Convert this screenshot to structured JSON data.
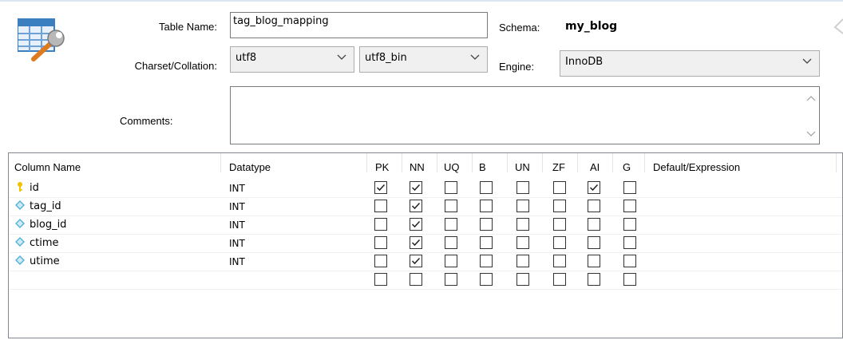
{
  "header": {
    "table_name_label": "Table Name:",
    "table_name_value": "tag_blog_mapping",
    "schema_label": "Schema:",
    "schema_value": "my_blog",
    "charset_label": "Charset/Collation:",
    "charset_value": "utf8",
    "collation_value": "utf8_bin",
    "engine_label": "Engine:",
    "engine_value": "InnoDB",
    "comments_label": "Comments:",
    "comments_value": ""
  },
  "icons": {
    "table_editor": "table-wrench-icon",
    "primary_key": "key-icon",
    "column": "diamond-icon",
    "dropdown": "chevron-down-icon"
  },
  "columns_header": {
    "name": "Column Name",
    "datatype": "Datatype",
    "pk": "PK",
    "nn": "NN",
    "uq": "UQ",
    "b": "B",
    "un": "UN",
    "zf": "ZF",
    "ai": "AI",
    "g": "G",
    "default": "Default/Expression"
  },
  "columns": [
    {
      "name": "id",
      "type": "INT",
      "pk": true,
      "nn": true,
      "uq": false,
      "b": false,
      "un": false,
      "zf": false,
      "ai": true,
      "g": false,
      "default": ""
    },
    {
      "name": "tag_id",
      "type": "INT",
      "pk": false,
      "nn": true,
      "uq": false,
      "b": false,
      "un": false,
      "zf": false,
      "ai": false,
      "g": false,
      "default": ""
    },
    {
      "name": "blog_id",
      "type": "INT",
      "pk": false,
      "nn": true,
      "uq": false,
      "b": false,
      "un": false,
      "zf": false,
      "ai": false,
      "g": false,
      "default": ""
    },
    {
      "name": "ctime",
      "type": "INT",
      "pk": false,
      "nn": true,
      "uq": false,
      "b": false,
      "un": false,
      "zf": false,
      "ai": false,
      "g": false,
      "default": ""
    },
    {
      "name": "utime",
      "type": "INT",
      "pk": false,
      "nn": true,
      "uq": false,
      "b": false,
      "un": false,
      "zf": false,
      "ai": false,
      "g": false,
      "default": ""
    }
  ],
  "colors": {
    "accent_key": "#f2c200",
    "accent_column": "#4fb3d9",
    "border": "#7a7a7a"
  }
}
